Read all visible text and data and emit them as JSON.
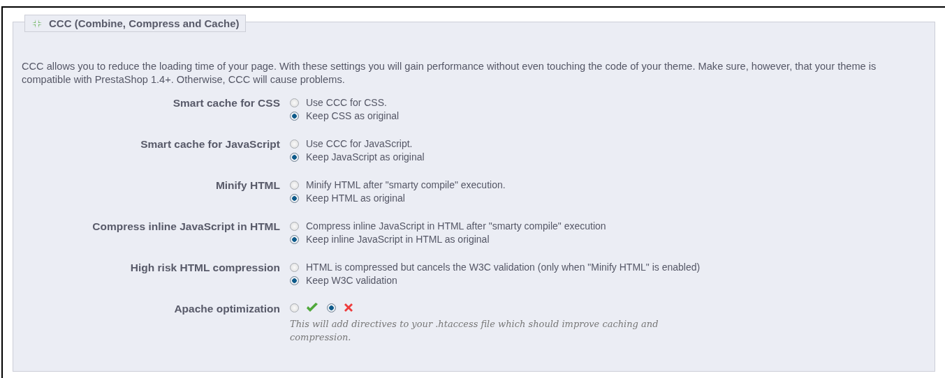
{
  "fieldset": {
    "legend": "CCC (Combine, Compress and Cache)",
    "intro": "CCC allows you to reduce the loading time of your page. With these settings you will gain performance without even touching the code of your theme. Make sure, however, that your theme is compatible with PrestaShop 1.4+. Otherwise, CCC will cause problems.",
    "settings": [
      {
        "label": "Smart cache for CSS",
        "kind": "stacked",
        "options": [
          {
            "kind": "text",
            "text": "Use CCC for CSS.",
            "selected": false
          },
          {
            "kind": "text",
            "text": "Keep CSS as original",
            "selected": true
          }
        ]
      },
      {
        "label": "Smart cache for JavaScript",
        "kind": "stacked",
        "options": [
          {
            "kind": "text",
            "text": "Use CCC for JavaScript.",
            "selected": false
          },
          {
            "kind": "text",
            "text": "Keep JavaScript as original",
            "selected": true
          }
        ]
      },
      {
        "label": "Minify HTML",
        "kind": "stacked",
        "options": [
          {
            "kind": "text",
            "text": "Minify HTML after \"smarty compile\" execution.",
            "selected": false
          },
          {
            "kind": "text",
            "text": "Keep HTML as original",
            "selected": true
          }
        ]
      },
      {
        "label": "Compress inline JavaScript in HTML",
        "kind": "stacked",
        "options": [
          {
            "kind": "text",
            "text": "Compress inline JavaScript in HTML after \"smarty compile\" execution",
            "selected": false
          },
          {
            "kind": "text",
            "text": "Keep inline JavaScript in HTML as original",
            "selected": true
          }
        ]
      },
      {
        "label": "High risk HTML compression",
        "kind": "stacked",
        "options": [
          {
            "kind": "text",
            "text": "HTML is compressed but cancels the W3C validation (only when \"Minify HTML\" is enabled)",
            "selected": false
          },
          {
            "kind": "text",
            "text": "Keep W3C validation",
            "selected": true
          }
        ]
      },
      {
        "label": "Apache optimization",
        "kind": "inline",
        "options": [
          {
            "kind": "yes",
            "selected": false
          },
          {
            "kind": "no",
            "selected": true
          }
        ],
        "hint": "This will add directives to your .htaccess file which should improve caching and compression."
      }
    ]
  }
}
